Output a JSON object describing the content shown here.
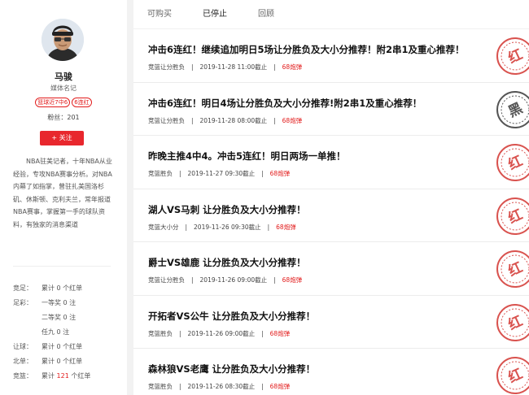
{
  "profile": {
    "name": "马骏",
    "role": "媒体名记",
    "badges": [
      "篮球近7中6",
      "6连红"
    ],
    "fans": "粉丝：201",
    "follow_label": "+ 关注",
    "intro": "NBA驻美记者，十年NBA从业经验，专攻NBA赛事分析。对NBA内幕了如指掌，曾驻扎美国洛杉矶、休斯顿、克利夫兰，常年报道NBA赛事，掌握第一手的球队资料，有独家的消息渠道",
    "stats": [
      {
        "key": "竞足：",
        "pre": "累计",
        "num": "0",
        "suf": "个红单",
        "red": false
      },
      {
        "key": "足彩：",
        "pre": "一等奖",
        "num": "0",
        "suf": "注",
        "red": false
      },
      {
        "key": "",
        "pre": "二等奖",
        "num": "0",
        "suf": "注",
        "red": false
      },
      {
        "key": "",
        "pre": "任九",
        "num": "0",
        "suf": "注",
        "red": false
      },
      {
        "key": "让球：",
        "pre": "累计",
        "num": "0",
        "suf": "个红单",
        "red": false
      },
      {
        "key": "北单：",
        "pre": "累计",
        "num": "0",
        "suf": "个红单",
        "red": false
      },
      {
        "key": "竞篮：",
        "pre": "累计",
        "num": "121",
        "suf": "个红单",
        "red": true
      }
    ]
  },
  "tabs": [
    "可购买",
    "已停止",
    "回顾"
  ],
  "active_tab": 1,
  "items": [
    {
      "title": "冲击6连红！继续追加明日5场让分胜负及大小分推荐！附2串1及重心推荐！",
      "category": "竞篮让分胜负",
      "time": "2019-11-28 11:00截止",
      "price": "68炮弹",
      "stamp": "red"
    },
    {
      "title": "冲击6连红！明日4场让分胜负及大小分推荐!附2串1及重心推荐！",
      "category": "竞篮让分胜负",
      "time": "2019-11-28 08:00截止",
      "price": "68炮弹",
      "stamp": "black"
    },
    {
      "title": "昨晚主推4中4。冲击5连红！明日两场一单推！",
      "category": "竞篮胜负",
      "time": "2019-11-27 09:30截止",
      "price": "68炮弹",
      "stamp": "red"
    },
    {
      "title": "湖人VS马刺 让分胜负及大小分推荐！",
      "category": "竞篮大小分",
      "time": "2019-11-26 09:30截止",
      "price": "68炮弹",
      "stamp": "red"
    },
    {
      "title": "爵士VS雄鹿 让分胜负及大小分推荐！",
      "category": "竞篮让分胜负",
      "time": "2019-11-26 09:00截止",
      "price": "68炮弹",
      "stamp": "red"
    },
    {
      "title": "开拓者VS公牛 让分胜负及大小分推荐！",
      "category": "竞篮胜负",
      "time": "2019-11-26 09:00截止",
      "price": "68炮弹",
      "stamp": "red"
    },
    {
      "title": "森林狼VS老鹰 让分胜负及大小分推荐！",
      "category": "竞篮胜负",
      "time": "2019-11-26 08:30截止",
      "price": "68炮弹",
      "stamp": "red"
    }
  ],
  "stamps": {
    "red": "红",
    "black": "黑"
  },
  "colors": {
    "accent": "#e8272d",
    "red_text": "#e21b1b",
    "stamp_red": "#d9534f",
    "stamp_black": "#555555"
  }
}
